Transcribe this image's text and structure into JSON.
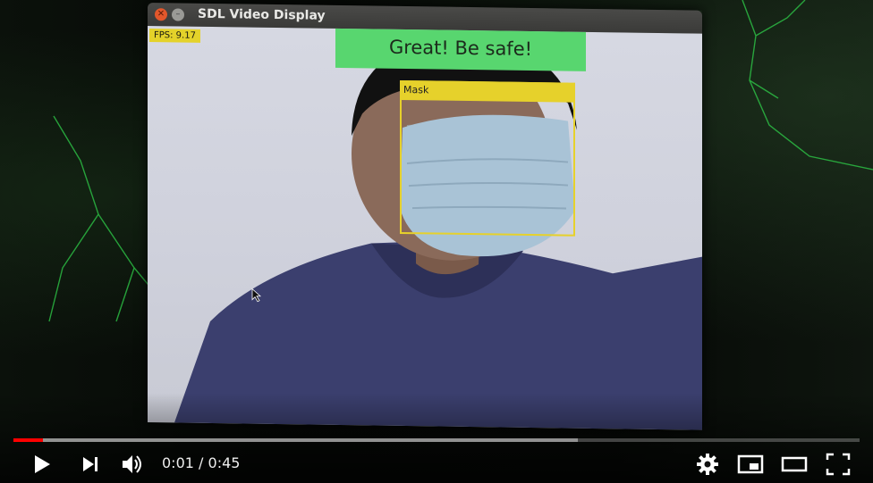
{
  "window": {
    "title": "SDL Video Display"
  },
  "video": {
    "fps_label": "FPS: 9.17",
    "status_message": "Great! Be safe!",
    "detection_label": "Mask",
    "colors": {
      "banner": "#58d66f",
      "box": "#e6d12b"
    }
  },
  "player": {
    "current_time": "0:01",
    "duration": "0:45",
    "time_separator": "/",
    "progress_played": 0.035,
    "progress_buffered": 0.667,
    "accent": "#ff0000",
    "icons": [
      "play-icon",
      "next-icon",
      "volume-icon",
      "settings-icon",
      "miniplayer-icon",
      "theater-icon",
      "fullscreen-icon"
    ]
  }
}
